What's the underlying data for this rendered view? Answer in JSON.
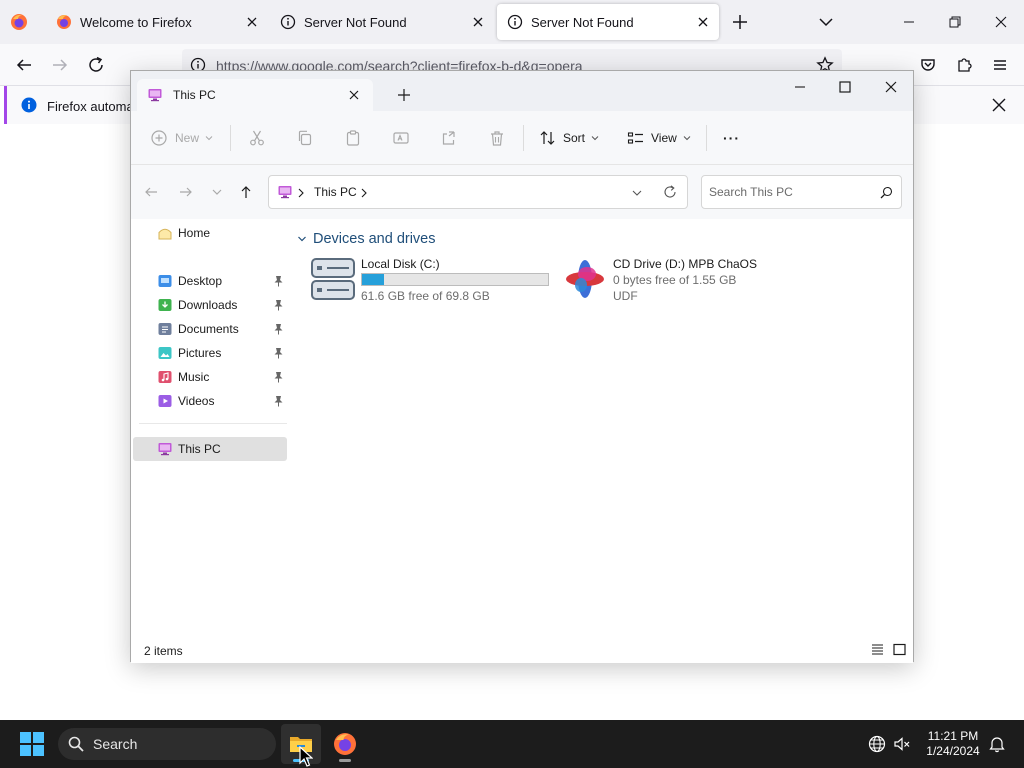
{
  "firefox": {
    "tabs": [
      {
        "label": "Welcome to Firefox",
        "icon": "firefox-icon",
        "active": false
      },
      {
        "label": "Server Not Found",
        "icon": "info-icon",
        "active": false
      },
      {
        "label": "Server Not Found",
        "icon": "info-icon",
        "active": true
      }
    ],
    "url": "https://www.google.com/search?client=firefox-b-d&q=opera",
    "notification": "Firefox automatio"
  },
  "explorer": {
    "tab_title": "This PC",
    "toolbar": {
      "new_label": "New",
      "sort_label": "Sort",
      "view_label": "View",
      "more_label": "···"
    },
    "address": {
      "segment": "This PC"
    },
    "search": {
      "placeholder": "Search This PC"
    },
    "nav": {
      "home": "Home",
      "quick_access": [
        {
          "label": "Desktop",
          "icon": "desktop-folder-icon",
          "color": "#3c8ee8"
        },
        {
          "label": "Downloads",
          "icon": "downloads-folder-icon",
          "color": "#3fb34f"
        },
        {
          "label": "Documents",
          "icon": "documents-folder-icon",
          "color": "#6f7f9c"
        },
        {
          "label": "Pictures",
          "icon": "pictures-folder-icon",
          "color": "#3cc6c6"
        },
        {
          "label": "Music",
          "icon": "music-folder-icon",
          "color": "#e0506e"
        },
        {
          "label": "Videos",
          "icon": "videos-folder-icon",
          "color": "#9b5de5"
        }
      ],
      "this_pc": "This PC"
    },
    "content": {
      "group_title": "Devices and drives",
      "drives": [
        {
          "name": "Local Disk (C:)",
          "detail": "61.6 GB free of 69.8 GB",
          "used_fraction": 0.12
        },
        {
          "name": "CD Drive (D:) MPB ChaOS",
          "detail": "0 bytes free of 1.55 GB",
          "filesystem": "UDF"
        }
      ]
    },
    "status": {
      "count": "2 items"
    }
  },
  "taskbar": {
    "search_label": "Search",
    "time": "11:21 PM",
    "date": "1/24/2024"
  },
  "colors": {
    "accent": "#0067c0",
    "usage_fill": "#26a0da",
    "taskbar": "#1c1c1c",
    "group_header": "#1f4e79"
  }
}
